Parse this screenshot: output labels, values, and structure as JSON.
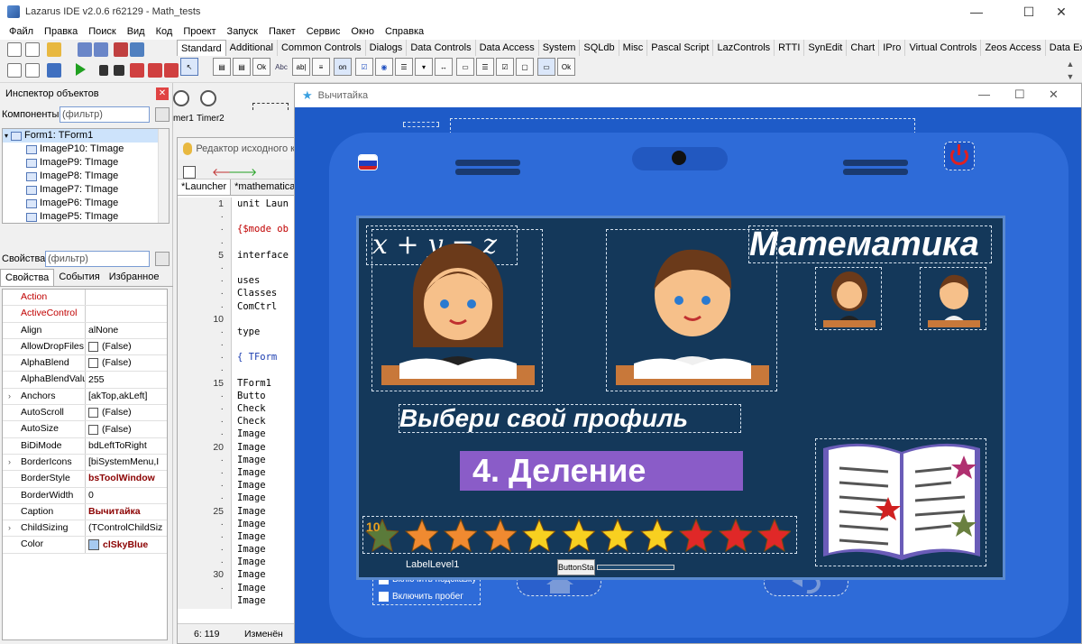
{
  "window": {
    "title": "Lazarus IDE v2.0.6 r62129 - Math_tests",
    "minimize": "—",
    "maximize": "☐",
    "close": "✕"
  },
  "menu": [
    "Файл",
    "Правка",
    "Поиск",
    "Вид",
    "Код",
    "Проект",
    "Запуск",
    "Пакет",
    "Сервис",
    "Окно",
    "Справка"
  ],
  "palette": {
    "tabs": [
      "Standard",
      "Additional",
      "Common Controls",
      "Dialogs",
      "Data Controls",
      "Data Access",
      "System",
      "SQLdb",
      "Misc",
      "Pascal Script",
      "LazControls",
      "RTTI",
      "SynEdit",
      "Chart",
      "IPro",
      "Virtual Controls",
      "Zeos Access",
      "Data Expo"
    ],
    "active_tab": "Standard",
    "icon_labels": {
      "ok": "Ok",
      "abc": "Abc",
      "abl": "ab|",
      "on": "on",
      "ok2": "Ok"
    }
  },
  "inspector": {
    "title": "Инспектор объектов",
    "components_label": "Компоненты",
    "filter_placeholder": "(фильтр)",
    "tree": [
      "Form1: TForm1",
      "ImageP10: TImage",
      "ImageP9: TImage",
      "ImageP8: TImage",
      "ImageP7: TImage",
      "ImageP6: TImage",
      "ImageP5: TImage"
    ],
    "props_label": "Свойства",
    "tabs": [
      "Свойства",
      "События",
      "Избранное"
    ],
    "properties": [
      {
        "name": "Action",
        "value": "",
        "red": true
      },
      {
        "name": "ActiveControl",
        "value": "",
        "red": true
      },
      {
        "name": "Align",
        "value": "alNone"
      },
      {
        "name": "AllowDropFiles",
        "value": "(False)",
        "check": true
      },
      {
        "name": "AlphaBlend",
        "value": "(False)",
        "check": true
      },
      {
        "name": "AlphaBlendValu",
        "value": "255"
      },
      {
        "name": "Anchors",
        "value": "[akTop,akLeft]",
        "expand": true
      },
      {
        "name": "AutoScroll",
        "value": "(False)",
        "check": true
      },
      {
        "name": "AutoSize",
        "value": "(False)",
        "check": true
      },
      {
        "name": "BiDiMode",
        "value": "bdLeftToRight"
      },
      {
        "name": "BorderIcons",
        "value": "[biSystemMenu,I",
        "expand": true
      },
      {
        "name": "BorderStyle",
        "value": "bsToolWindow",
        "bold": true
      },
      {
        "name": "BorderWidth",
        "value": "0"
      },
      {
        "name": "Caption",
        "value": "Вычитайка",
        "bold": true
      },
      {
        "name": "ChildSizing",
        "value": "(TControlChildSiz",
        "expand": true
      },
      {
        "name": "Color",
        "value": "clSkyBlue",
        "bold": true,
        "swatch": true
      }
    ]
  },
  "timers": {
    "timer1": "mer1",
    "timer2": "Timer2"
  },
  "editor": {
    "title": "Редактор исходного к",
    "tabs": [
      "*Launcher",
      "*mathematical"
    ],
    "line_numbers": [
      "1",
      "·",
      "·",
      "·",
      "5",
      "·",
      "·",
      "·",
      "·",
      "10",
      "·",
      "·",
      "·",
      "·",
      "15",
      "·",
      "·",
      "·",
      "·",
      "20",
      "·",
      "·",
      "·",
      "·",
      "25",
      "·",
      "·",
      "·",
      "·",
      "30",
      "·"
    ],
    "lines": [
      {
        "t": "unit Laun",
        "c": "#000"
      },
      {
        "t": "",
        "c": "#000"
      },
      {
        "t": "{$mode ob",
        "c": "#c00000"
      },
      {
        "t": "",
        "c": "#000"
      },
      {
        "t": "interface",
        "c": "#000"
      },
      {
        "t": "",
        "c": "#000"
      },
      {
        "t": "uses",
        "c": "#000"
      },
      {
        "t": "  Classes",
        "c": "#000"
      },
      {
        "t": "  ComCtrl",
        "c": "#000"
      },
      {
        "t": "",
        "c": "#000"
      },
      {
        "t": "type",
        "c": "#000"
      },
      {
        "t": "",
        "c": "#000"
      },
      {
        "t": "  { TForm",
        "c": "#1a3cb0"
      },
      {
        "t": "",
        "c": "#000"
      },
      {
        "t": "  TForm1",
        "c": "#000"
      },
      {
        "t": "    Butto",
        "c": "#000"
      },
      {
        "t": "    Check",
        "c": "#000"
      },
      {
        "t": "    Check",
        "c": "#000"
      },
      {
        "t": "    Image",
        "c": "#000"
      },
      {
        "t": "    Image",
        "c": "#000"
      },
      {
        "t": "    Image",
        "c": "#000"
      },
      {
        "t": "    Image",
        "c": "#000"
      },
      {
        "t": "    Image",
        "c": "#000"
      },
      {
        "t": "    Image",
        "c": "#000"
      },
      {
        "t": "    Image",
        "c": "#000"
      },
      {
        "t": "    Image",
        "c": "#000"
      },
      {
        "t": "    Image",
        "c": "#000"
      },
      {
        "t": "    Image",
        "c": "#000"
      },
      {
        "t": "    Image",
        "c": "#000"
      },
      {
        "t": "    Image",
        "c": "#000"
      },
      {
        "t": "    Image",
        "c": "#000"
      },
      {
        "t": "    Image",
        "c": "#000"
      }
    ],
    "status_pos": "6: 119",
    "status_mod": "Изменён"
  },
  "form": {
    "title": "Вычитайка",
    "subject_title": "Математика",
    "choose_profile": "Выбери свой профиль",
    "level": "4. Деление",
    "board_text": "x + y = z",
    "level_label": "LabelLevel1",
    "start_button": "ButtonStar",
    "score_badge": "10",
    "checkbox_hint": "Включить подсказку",
    "checkbox_trial": "Включить пробег",
    "stars": [
      "orange",
      "orange",
      "orange",
      "yellow",
      "yellow",
      "yellow",
      "yellow",
      "red",
      "red",
      "red"
    ],
    "colors": {
      "form_bg": "#1e5bc8",
      "tablet": "#2e6bd8",
      "screen": "#14385a",
      "level_box": "#8a5cc8"
    }
  }
}
